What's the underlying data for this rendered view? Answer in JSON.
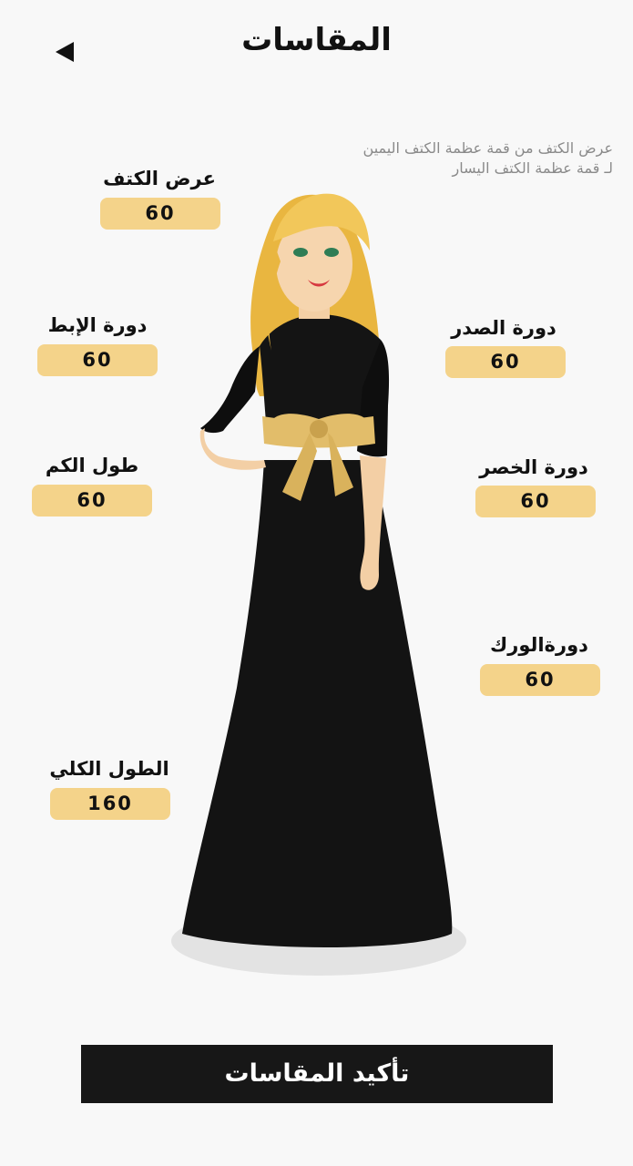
{
  "header": {
    "title": "المقاسات"
  },
  "hint": "عرض الكتف من قمة عظمة الكتف اليمين لـ قمة عظمة الكتف اليسار",
  "measurements": {
    "shoulder": {
      "label": "عرض الكتف",
      "value": "60"
    },
    "armhole": {
      "label": "دورة الإبط",
      "value": "60"
    },
    "sleeve": {
      "label": "طول الكم",
      "value": "60"
    },
    "total_length": {
      "label": "الطول الكلي",
      "value": "160"
    },
    "chest": {
      "label": "دورة الصدر",
      "value": "60"
    },
    "waist": {
      "label": "دورة الخصر",
      "value": "60"
    },
    "hip": {
      "label": "دورةالورك",
      "value": "60"
    }
  },
  "confirm_label": "تأكيد المقاسات",
  "colors": {
    "accent": "#f4d38a",
    "button": "#171717",
    "dress": "#111111",
    "hair": "#f0c24a",
    "bow": "#e2bd6a"
  }
}
